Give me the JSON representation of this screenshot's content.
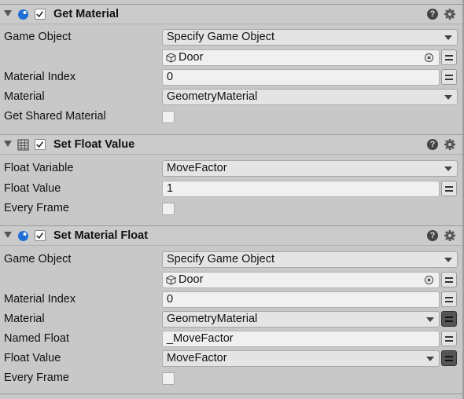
{
  "get_material": {
    "title": "Get Material",
    "rows": {
      "game_object_label": "Game Object",
      "game_object_value": "Specify Game Object",
      "object_ref": "Door",
      "material_index_label": "Material Index",
      "material_index_value": "0",
      "material_label": "Material",
      "material_value": "GeometryMaterial",
      "get_shared_label": "Get Shared Material"
    }
  },
  "set_float": {
    "title": "Set Float Value",
    "rows": {
      "float_variable_label": "Float Variable",
      "float_variable_value": "MoveFactor",
      "float_value_label": "Float Value",
      "float_value_value": "1",
      "every_frame_label": "Every Frame"
    }
  },
  "set_material_float": {
    "title": "Set Material Float",
    "rows": {
      "game_object_label": "Game Object",
      "game_object_value": "Specify Game Object",
      "object_ref": "Door",
      "material_index_label": "Material Index",
      "material_index_value": "0",
      "material_label": "Material",
      "material_value": "GeometryMaterial",
      "named_float_label": "Named Float",
      "named_float_value": "_MoveFactor",
      "float_value_label": "Float Value",
      "float_value_value": "MoveFactor",
      "every_frame_label": "Every Frame"
    }
  },
  "icons": {
    "action_icon": "blue-sphere-icon",
    "float_icon": "grid-icon",
    "help": "?",
    "settings": "gear-icon"
  },
  "colors": {
    "panel_bg": "#c8c8c8",
    "field_bg": "#f0f0f0",
    "accent_blue": "#1f6fd6"
  }
}
